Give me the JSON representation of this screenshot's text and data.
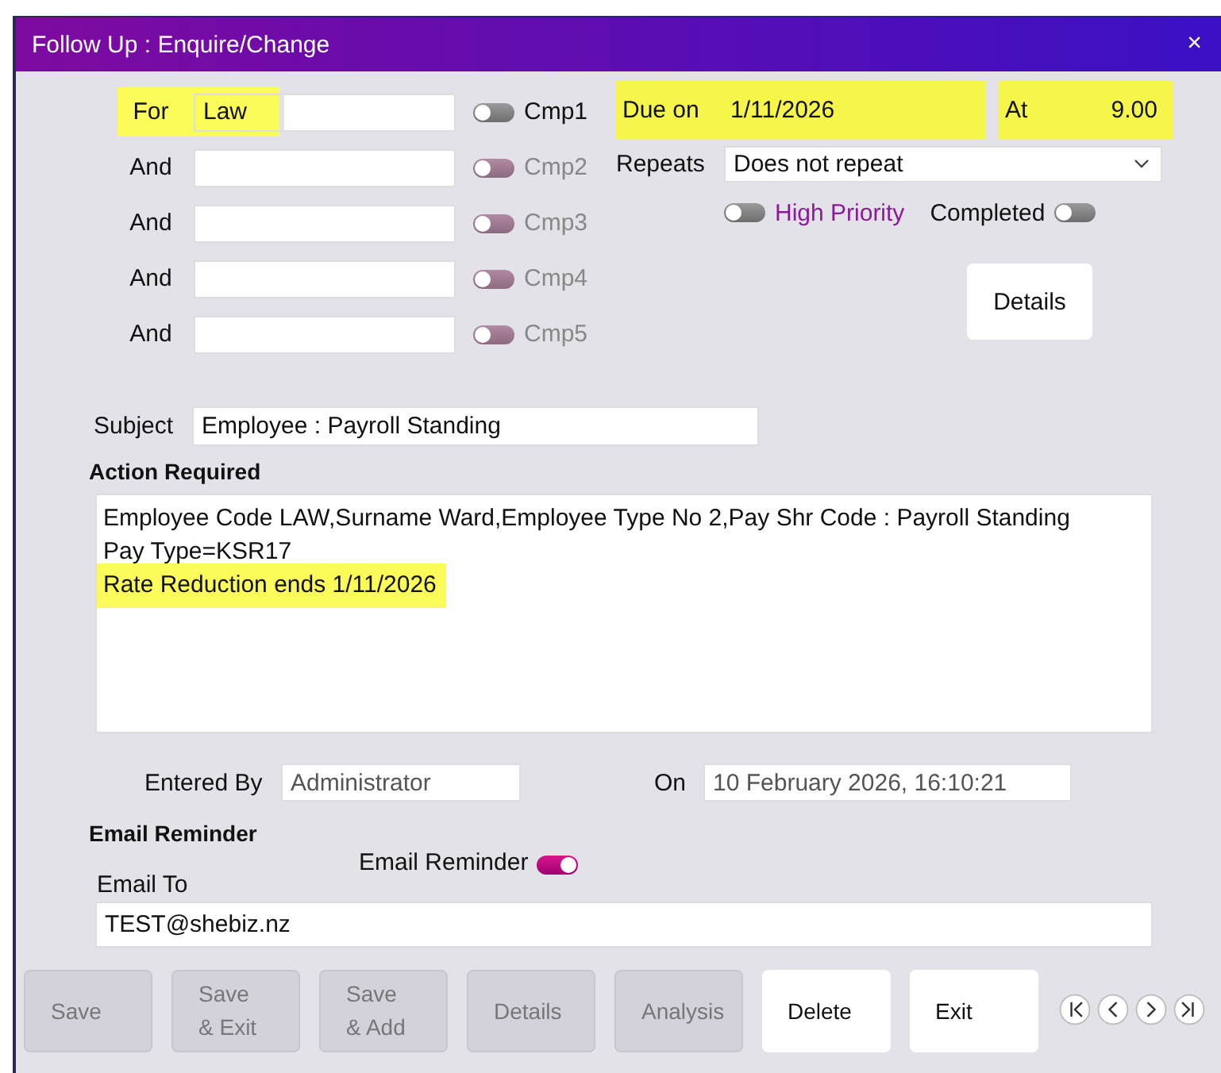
{
  "window": {
    "title": "Follow Up : Enquire/Change",
    "close": "×"
  },
  "for_rows": [
    {
      "label": "For",
      "value": "Law",
      "highlighted": true,
      "cmp": {
        "label": "Cmp1",
        "on": false,
        "disabled": false
      }
    },
    {
      "label": "And",
      "highlighted": false,
      "cmp": {
        "label": "Cmp2",
        "on": false,
        "disabled": true
      }
    },
    {
      "label": "And",
      "highlighted": false,
      "cmp": {
        "label": "Cmp3",
        "on": false,
        "disabled": true
      }
    },
    {
      "label": "And",
      "highlighted": false,
      "cmp": {
        "label": "Cmp4",
        "on": false,
        "disabled": true
      }
    },
    {
      "label": "And",
      "highlighted": false,
      "cmp": {
        "label": "Cmp5",
        "on": false,
        "disabled": true
      }
    }
  ],
  "due": {
    "label": "Due on",
    "value": "1/11/2026",
    "highlighted": true
  },
  "at": {
    "label": "At",
    "value": "9.00",
    "highlighted": true
  },
  "repeats": {
    "label": "Repeats",
    "value": "Does not repeat"
  },
  "high_priority": {
    "label": "High Priority",
    "on": false
  },
  "completed": {
    "label": "Completed",
    "on": false
  },
  "details_button": {
    "label": "Details"
  },
  "subject": {
    "label": "Subject",
    "value": "Employee : Payroll Standing"
  },
  "action_required": {
    "heading": "Action Required",
    "lines": [
      {
        "text": "Employee Code LAW,Surname Ward,Employee Type No 2,Pay Shr Code  : Payroll Standing",
        "highlighted": false
      },
      {
        "text": "Pay Type=KSR17",
        "highlighted": false
      },
      {
        "text": "Rate Reduction ends 1/11/2026",
        "highlighted": true
      }
    ]
  },
  "entered_by": {
    "label": "Entered By",
    "value": "Administrator"
  },
  "entered_on": {
    "label": "On",
    "value": "10 February 2026, 16:10:21"
  },
  "email_reminder": {
    "heading": "Email Reminder",
    "toggle_label": "Email Reminder",
    "on": true
  },
  "email_to": {
    "label": "Email To",
    "value": "TEST@shebiz.nz"
  },
  "buttons": [
    {
      "lines": [
        "Save"
      ],
      "disabled": true
    },
    {
      "lines": [
        "Save",
        "& Exit"
      ],
      "disabled": true
    },
    {
      "lines": [
        "Save",
        "& Add"
      ],
      "disabled": true
    },
    {
      "lines": [
        "Details"
      ],
      "disabled": true
    },
    {
      "lines": [
        "Analysis"
      ],
      "disabled": true
    },
    {
      "lines": [
        "Delete"
      ],
      "disabled": false
    },
    {
      "lines": [
        "Exit"
      ],
      "disabled": false
    }
  ],
  "nav_buttons": [
    {
      "kind": "first"
    },
    {
      "kind": "previous"
    },
    {
      "kind": "next"
    },
    {
      "kind": "last"
    }
  ]
}
